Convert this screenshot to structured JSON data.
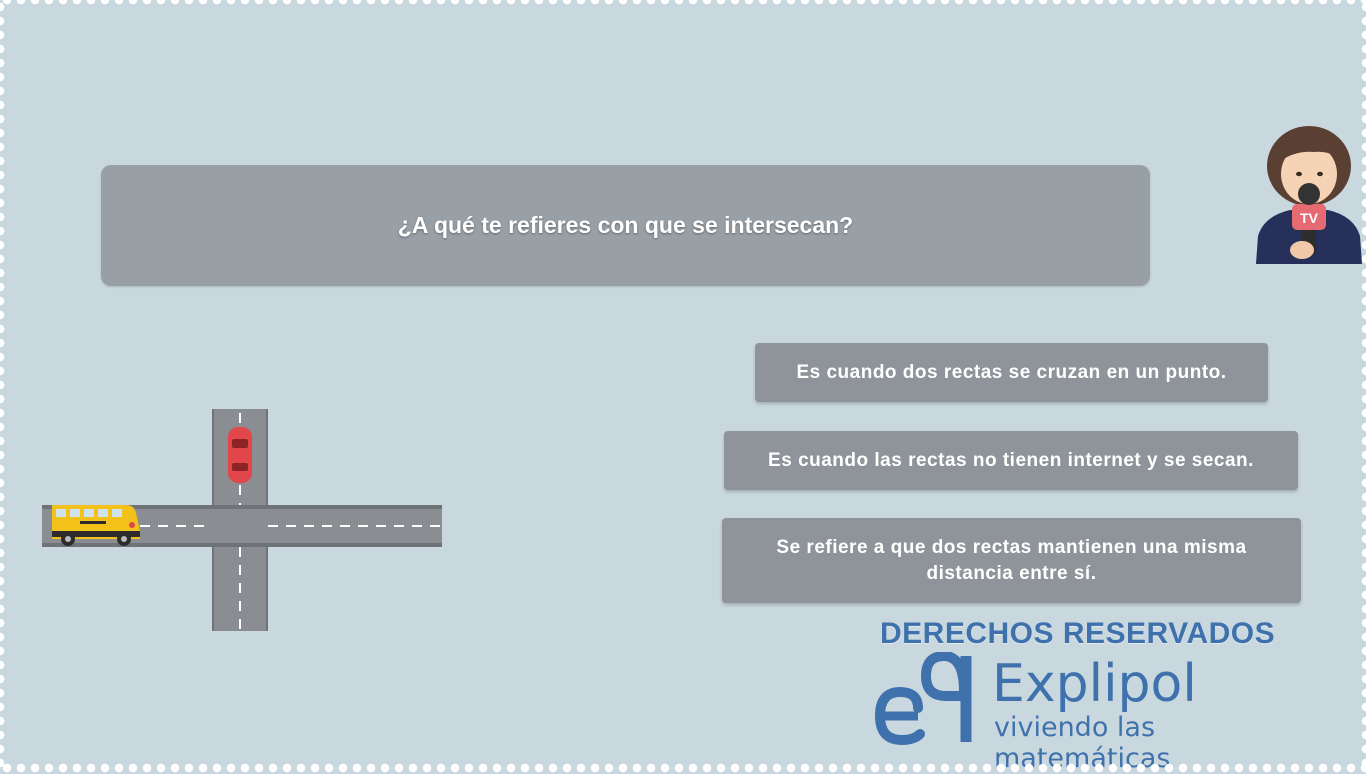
{
  "question": {
    "text": "¿A qué te refieres con que se intersecan?"
  },
  "options": [
    {
      "text": "Es cuando dos rectas se cruzan en un punto."
    },
    {
      "text": "Es cuando las rectas no tienen internet y se secan."
    },
    {
      "text": "Se refiere a que dos rectas mantienen una misma distancia entre sí."
    }
  ],
  "reporter": {
    "mic_label": "TV"
  },
  "footer": {
    "copyright": "DERECHOS RESERVADOS",
    "brand": "Explipol",
    "tagline": "viviendo las matemáticas"
  },
  "colors": {
    "background": "#c9d8de",
    "panel": "#98a0a6",
    "option": "#8e9499",
    "brand_blue": "#3f72ad",
    "road": "#6f7277",
    "bus": "#f2c21b",
    "car": "#e0464a"
  },
  "icons": [
    "reporter-icon",
    "microphone-icon",
    "school-bus-icon",
    "red-car-icon",
    "road-intersection-icon",
    "explipol-logo-icon"
  ]
}
